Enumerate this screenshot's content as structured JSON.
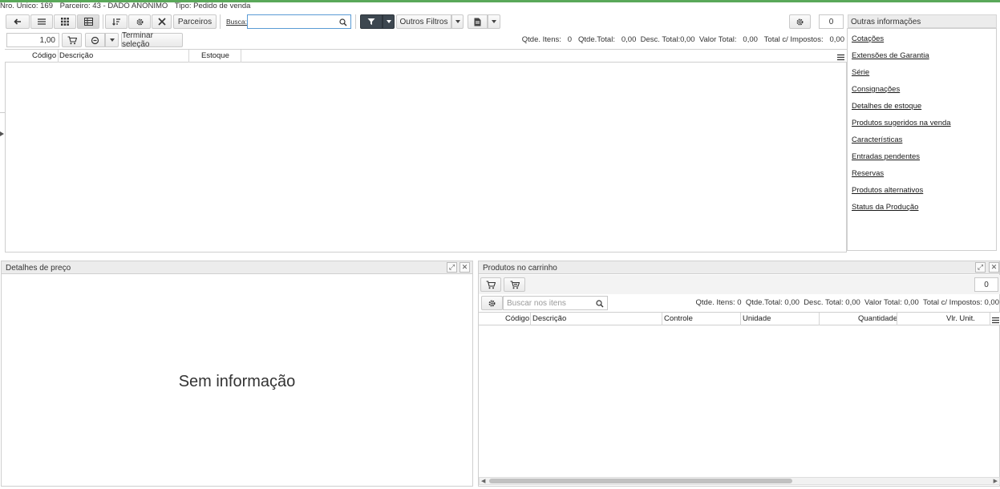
{
  "header": {
    "nro_unico": "Nro. Unico: 169",
    "parceiro": "Parceiro: 43 - DADO ANONIMO",
    "tipo": "Tipo: Pedido de venda"
  },
  "toolbar": {
    "parceiros_label": "Parceiros",
    "busca_label": "Busca:",
    "busca_value": "",
    "outros_filtros_label": "Outros Filtros",
    "count_value": "0"
  },
  "toolbar2": {
    "quantity_value": "1,00",
    "terminar_label": "Terminar seleção",
    "summary": "Qtde. Itens:   0   Qtde.Total:   0,00  Desc. Total:0,00  Valor Total:   0,00   Total c/ Impostos:   0,00"
  },
  "product_grid": {
    "columns": [
      "Código",
      "Descrição",
      "Estoque"
    ]
  },
  "side_panel": {
    "title": "Outras informações",
    "links": [
      "Cotações",
      "Extensões de Garantia",
      "Série",
      "Consignações",
      "Detalhes de estoque",
      "Produtos sugeridos na venda",
      "Características",
      "Entradas pendentes",
      "Reservas",
      "Produtos alternativos",
      "Status da Produção"
    ]
  },
  "price_details": {
    "title": "Detalhes de preço",
    "empty_message": "Sem informação"
  },
  "cart": {
    "title": "Produtos no carrinho",
    "count_value": "0",
    "search_placeholder": "Buscar nos itens",
    "summary": "Qtde. Itens: 0  Qtde.Total: 0,00  Desc. Total: 0,00  Valor Total: 0,00  Total c/ Impostos: 0,00",
    "columns": [
      "Código",
      "Descrição",
      "Controle",
      "Unidade",
      "Quantidade",
      "Vlr. Unit."
    ]
  }
}
